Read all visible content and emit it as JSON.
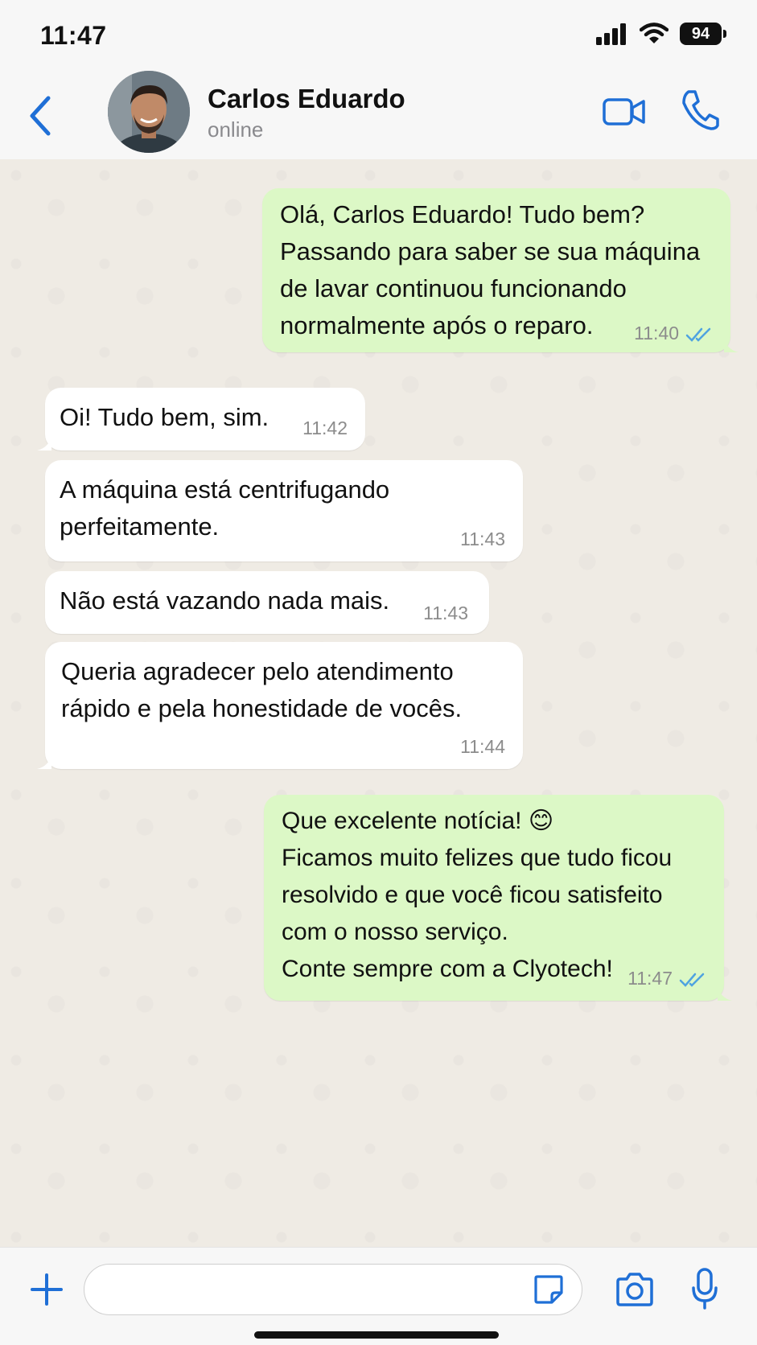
{
  "status_bar": {
    "time": "11:47",
    "battery": "94",
    "icons": [
      "signal-icon",
      "wifi-icon",
      "battery-icon"
    ]
  },
  "header": {
    "back_icon": "chevron-left-icon",
    "contact_name": "Carlos Eduardo",
    "contact_status": "online",
    "actions": [
      "video-call-icon",
      "phone-icon"
    ]
  },
  "messages": [
    {
      "direction": "outgoing",
      "text": "Olá, Carlos Eduardo! Tudo bem?\nPassando para saber se sua máquina\nde lavar continuou funcionando\nnormalmente após o reparo.",
      "time": "11:40",
      "read": true
    },
    {
      "direction": "incoming",
      "text": "Oi! Tudo bem, sim.",
      "time": "11:42"
    },
    {
      "direction": "incoming",
      "text": "A máquina está centrifugando\nperfeitamente.",
      "time": "11:43"
    },
    {
      "direction": "incoming",
      "text": "Não está vazando nada mais.",
      "time": "11:43"
    },
    {
      "direction": "incoming",
      "text": "Queria agradecer pelo atendimento\nrápido e pela honestidade de vocês.",
      "time": "11:44"
    },
    {
      "direction": "outgoing",
      "text": "Que excelente notícia! 😊\nFicamos muito felizes que tudo ficou\nresolvido e que você ficou satisfeito\ncom o nosso serviço.\nConte sempre com a Clyotech!",
      "time": "11:47",
      "read": true
    }
  ],
  "composer": {
    "input_value": "",
    "icons": [
      "plus-icon",
      "sticker-icon",
      "camera-icon",
      "microphone-icon"
    ]
  },
  "colors": {
    "accent": "#1f6fd6",
    "outgoing_bubble": "#dcf8c6",
    "incoming_bubble": "#ffffff",
    "read_ticks": "#4fa3e0",
    "chat_background": "#efebe4"
  }
}
